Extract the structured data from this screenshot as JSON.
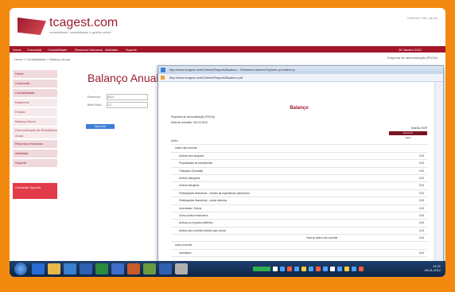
{
  "app": {
    "logo_text": "tcagest.com",
    "logo_sub": "contabilidade, contabilidade e gestão online",
    "top_links": "Utilizador   Sair   |   Ajuda",
    "nav_items": [
      "Home",
      "Comercial",
      "Contabilidade",
      "Recursos Humanos",
      "Atividade",
      "Suporte"
    ],
    "nav_right": "26 Janeiro 2012",
    "breadcrumb": "Home > Contabilidade > Balanço Anual",
    "right_dd": "Empresa de demonstração (PDCA)"
  },
  "sidebar": {
    "items": [
      {
        "label": "Home",
        "sub": false
      },
      {
        "label": "Comercial",
        "sub": false
      },
      {
        "label": "Contabilidade",
        "sub": false
      },
      {
        "label": "Balancete",
        "sub": true
      },
      {
        "label": "Extrato",
        "sub": true
      },
      {
        "label": "Balanço Anual",
        "sub": true
      },
      {
        "label": "Demonstração de Resultados Anual",
        "sub": true
      },
      {
        "label": "Recursos Humanos",
        "sub": false
      },
      {
        "label": "Atividade",
        "sub": false
      },
      {
        "label": "Suporte",
        "sub": false
      }
    ],
    "cta": "Contactar Suporte"
  },
  "main": {
    "title": "Balanço Anual",
    "exercicio_label": "Exercício",
    "exercicio_value": "2012",
    "mes_label": "Mês Final",
    "mes_value": "12",
    "button": "Imprimir"
  },
  "popup": {
    "title": "http://www.tcagest.com/Cliente/Reports/Balanco - Windows Internet Explorer provided by",
    "address": "http://www.tcagest.com/Cliente/Reports/Balanco.pdf",
    "doc_title": "Balanço",
    "company": "Empresa de demonstração (PDCA)",
    "date": "Data de emissão: 26-01-2012",
    "currency": "Moeda: EUR",
    "col_header": "Exercício",
    "col_year": "2012",
    "rows": [
      {
        "label": "Activo",
        "value": "",
        "indent": 0
      },
      {
        "label": "Activo não corrente",
        "value": "",
        "indent": 1
      },
      {
        "label": "Activos fixos tangíveis",
        "value": "0,00",
        "indent": 2
      },
      {
        "label": "Propriedades de investimento",
        "value": "0,00",
        "indent": 2
      },
      {
        "label": "Trespasse (Goodwill)",
        "value": "0,00",
        "indent": 2
      },
      {
        "label": "Activos intangíveis",
        "value": "0,00",
        "indent": 2
      },
      {
        "label": "Activos biológicos",
        "value": "0,00",
        "indent": 2
      },
      {
        "label": "Participações financeiras - método da equivalência patrimonial",
        "value": "0,00",
        "indent": 2
      },
      {
        "label": "Participações financeiras - outros métodos",
        "value": "0,00",
        "indent": 2
      },
      {
        "label": "Accionistas / Sócios",
        "value": "0,00",
        "indent": 2
      },
      {
        "label": "Outros activos financeiros",
        "value": "0,00",
        "indent": 2
      },
      {
        "label": "Activos por impostos diferidos",
        "value": "0,00",
        "indent": 2
      },
      {
        "label": "Activos não correntes detidos para venda",
        "value": "0,00",
        "indent": 2
      },
      {
        "label": "Total do Activo não corrente",
        "value": "0,00",
        "indent": 3
      },
      {
        "label": "Activo corrente",
        "value": "",
        "indent": 1
      },
      {
        "label": "Inventários",
        "value": "0,00",
        "indent": 2
      }
    ]
  },
  "taskbar": {
    "time": "11:21",
    "date": "26-01-2012"
  }
}
